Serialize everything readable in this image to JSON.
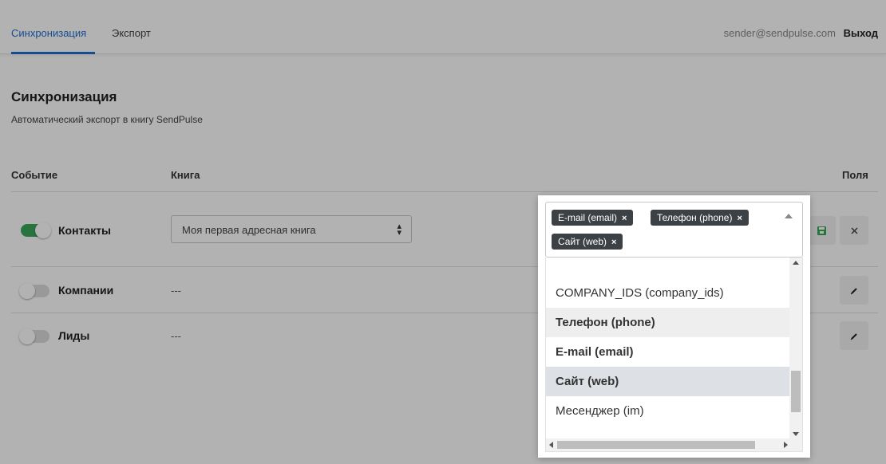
{
  "nav": {
    "tabs": [
      {
        "label": "Синхронизация",
        "active": true
      },
      {
        "label": "Экспорт",
        "active": false
      }
    ],
    "user_email": "sender@sendpulse.com",
    "logout_label": "Выход"
  },
  "page": {
    "title": "Синхронизация",
    "subtitle": "Автоматический экспорт в книгу SendPulse"
  },
  "table": {
    "headers": {
      "event": "Событие",
      "book": "Книга",
      "fields": "Поля"
    },
    "rows": [
      {
        "label": "Контакты",
        "enabled": true,
        "book": "Моя первая адресная книга",
        "save_icon": "save-icon",
        "close_icon": "close-icon"
      },
      {
        "label": "Компании",
        "enabled": false,
        "book": "---",
        "edit_icon": "pencil-icon"
      },
      {
        "label": "Лиды",
        "enabled": false,
        "book": "---",
        "edit_icon": "pencil-icon"
      }
    ]
  },
  "fields_dropdown": {
    "selected_tags": [
      "E-mail (email)",
      "Телефон (phone)",
      "Сайт (web)"
    ],
    "remove_symbol": "×",
    "options": [
      {
        "label": "COMPANY_IDS (company_ids)",
        "selected": false
      },
      {
        "label": "Телефон (phone)",
        "selected": true
      },
      {
        "label": "E-mail (email)",
        "selected": true
      },
      {
        "label": "Сайт (web)",
        "selected": true,
        "hovered": true
      },
      {
        "label": "Месенджер (im)",
        "selected": false
      }
    ]
  },
  "colors": {
    "accent": "#1f6fd1",
    "toggle_on": "#3aa55a",
    "tag_bg": "#3c4146",
    "save_icon": "#3aa55a"
  }
}
